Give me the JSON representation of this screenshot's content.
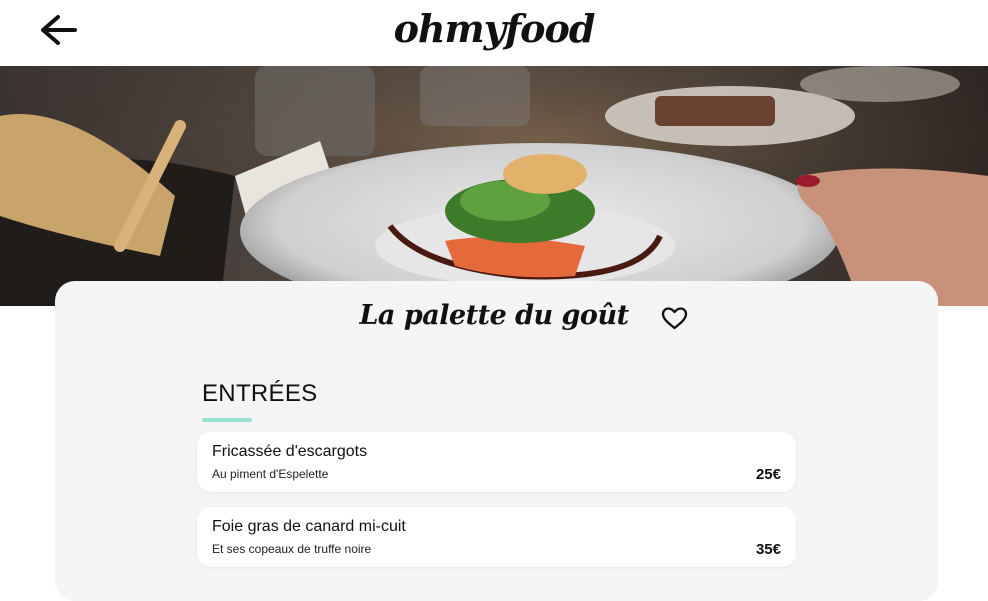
{
  "header": {
    "back_icon": "arrow-left-icon",
    "logo": "ohmyfood"
  },
  "hero": {
    "image_alt": "plated dish on restaurant table"
  },
  "restaurant": {
    "name": "La palette du goût",
    "favorite_icon": "heart-outline-icon"
  },
  "menu": {
    "section_title": "ENTRÉES",
    "accent_color": "#99e2d0",
    "dishes": [
      {
        "name": "Fricassée d'escargots",
        "description": "Au piment d'Espelette",
        "price": "25€"
      },
      {
        "name": "Foie gras de canard mi-cuit",
        "description": "Et ses copeaux de truffe noire",
        "price": "35€"
      }
    ]
  }
}
